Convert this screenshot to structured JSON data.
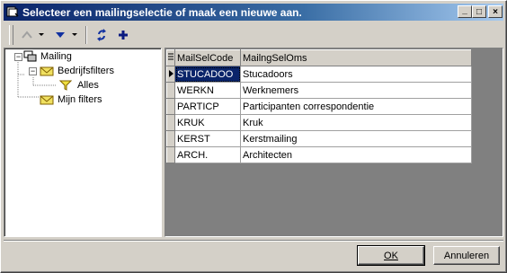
{
  "window": {
    "title": "Selecteer een mailingselectie of maak een nieuwe aan."
  },
  "titlebar_buttons": {
    "minimize": "_",
    "maximize": "□",
    "close": "×"
  },
  "toolbar": {
    "icons": [
      "arrow-up-icon",
      "dropdown-arrow-icon",
      "arrow-down-icon",
      "dropdown-arrow-icon",
      "refresh-icon",
      "add-icon"
    ]
  },
  "tree": {
    "root": "Mailing",
    "children": [
      {
        "label": "Bedrijfsfilters",
        "children": [
          {
            "label": "Alles"
          }
        ]
      },
      {
        "label": "Mijn filters"
      }
    ]
  },
  "grid": {
    "columns": [
      "MailSelCode",
      "MailngSelOms"
    ],
    "rows": [
      {
        "code": "STUCADOO",
        "oms": "Stucadoors"
      },
      {
        "code": "WERKN",
        "oms": "Werknemers"
      },
      {
        "code": "PARTICP",
        "oms": "Participanten correspondentie"
      },
      {
        "code": "KRUK",
        "oms": "Kruk"
      },
      {
        "code": "KERST",
        "oms": "Kerstmailing"
      },
      {
        "code": "ARCH.",
        "oms": "Architecten"
      }
    ],
    "selected_row": 0
  },
  "buttons": {
    "ok": "OK",
    "cancel": "Annuleren"
  }
}
